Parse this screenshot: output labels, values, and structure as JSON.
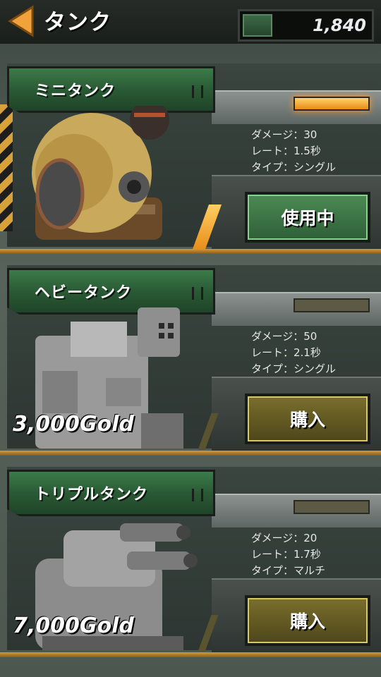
{
  "header": {
    "title": "タンク",
    "gold": "1,840",
    "back_icon": "back-arrow-icon",
    "currency_icon": "gold-currency-icon"
  },
  "colors": {
    "accent_orange": "#e88b17",
    "plate_green": "#2a5a35",
    "active_button": "#3f7a48",
    "buy_button": "#6b6124"
  },
  "tanks": [
    {
      "name": "ミニタンク",
      "rate_bar_active": true,
      "stats": [
        "ダメージ：30",
        "レート：1.5秒",
        "タイプ：シングル"
      ],
      "button_label": "使用中",
      "price": ""
    },
    {
      "name": "ヘビータンク",
      "rate_bar_active": false,
      "stats": [
        "ダメージ：50",
        "レート：2.1秒",
        "タイプ：シングル"
      ],
      "button_label": "購入",
      "price": "3,000Gold"
    },
    {
      "name": "トリプルタンク",
      "rate_bar_active": false,
      "stats": [
        "ダメージ：20",
        "レート：1.7秒",
        "タイプ：マルチ"
      ],
      "button_label": "購入",
      "price": "7,000Gold"
    }
  ]
}
